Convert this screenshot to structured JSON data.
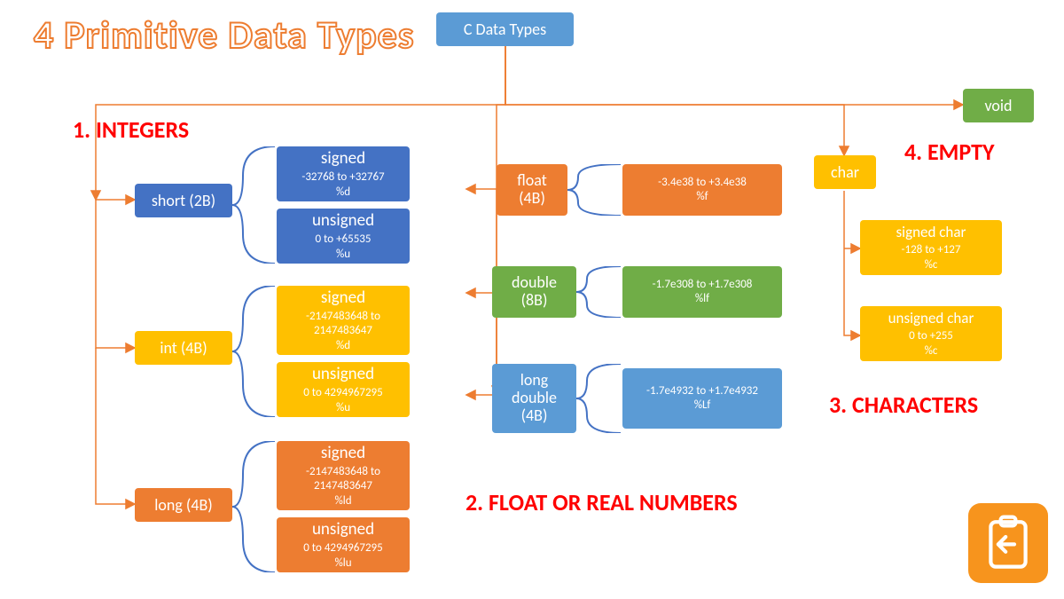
{
  "title": "4 Primitive Data Types",
  "root": "C Data Types",
  "sections": {
    "s1": "1. INTEGERS",
    "s2": "2. FLOAT OR REAL NUMBERS",
    "s3": "3. CHARACTERS",
    "s4": "4. EMPTY"
  },
  "integers": {
    "short": {
      "label": "short (2B)",
      "signed": {
        "t": "signed",
        "r": "-32768 to +32767",
        "f": "%d"
      },
      "unsigned": {
        "t": "unsigned",
        "r": "0 to +65535",
        "f": "%u"
      }
    },
    "int": {
      "label": "int (4B)",
      "signed": {
        "t": "signed",
        "r": "-2147483648 to 2147483647",
        "f": "%d"
      },
      "unsigned": {
        "t": "unsigned",
        "r": "0 to 4294967295",
        "f": "%u"
      }
    },
    "long": {
      "label": "long (4B)",
      "signed": {
        "t": "signed",
        "r": "-2147483648 to 2147483647",
        "f": "%ld"
      },
      "unsigned": {
        "t": "unsigned",
        "r": "0 to 4294967295",
        "f": "%lu"
      }
    }
  },
  "floats": {
    "float": {
      "label": "float (4B)",
      "r": "-3.4e38 to +3.4e38",
      "f": "%f"
    },
    "double": {
      "label": "double (8B)",
      "r": "-1.7e308 to +1.7e308",
      "f": "%lf"
    },
    "longdouble": {
      "label": "long double (4B)",
      "r": "-1.7e4932 to +1.7e4932",
      "f": "%Lf"
    }
  },
  "chars": {
    "char": {
      "label": "char"
    },
    "signed": {
      "t": "signed char",
      "r": "-128 to +127",
      "f": "%c"
    },
    "unsigned": {
      "t": "unsigned char",
      "r": "0 to +255",
      "f": "%c"
    }
  },
  "void": "void"
}
